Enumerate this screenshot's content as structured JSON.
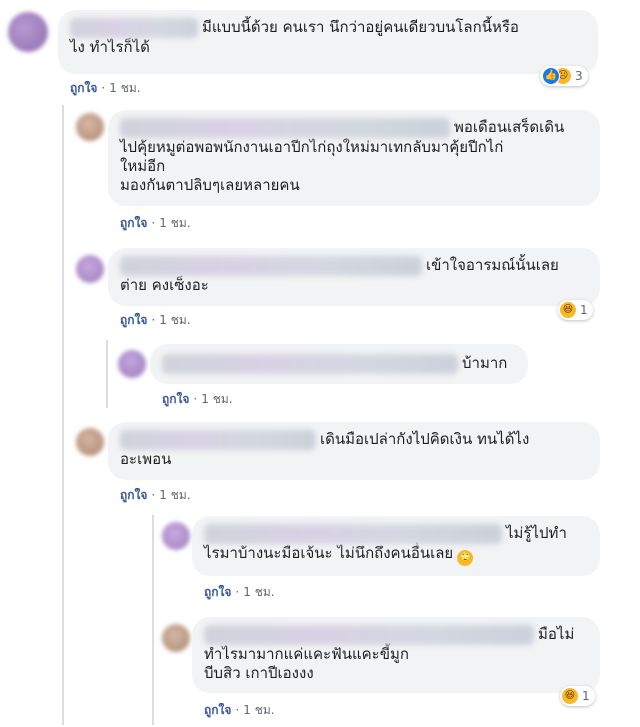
{
  "comments": [
    {
      "text": "มีแบบนี้ด้วย คนเรา นึกว่าอยู่คนเดียวบนโลกนี้หรือ\nไง ทำไรก็ได้",
      "like_label": "ถูกใจ",
      "time": "1 ชม.",
      "reaction_count": "3"
    },
    {
      "text_line1": "พอเดือนเสร็ดเดิน",
      "text_rest": "ไปคุ้ยหมูต่อพอพนักงานเอาปีกไก่ถุงใหม่มาเทกลับมาคุ้ยปีกไก่\nใหม่อีก\nมองกันตาปลิบๆเลยหลายคน",
      "like_label": "ถูกใจ",
      "time": "1 ชม."
    },
    {
      "text_line1": "เข้าใจอารมณ์นั้นเลย",
      "text_rest": "ต่าย คงเซ็งอะ",
      "like_label": "ถูกใจ",
      "time": "1 ชม.",
      "reaction_count": "1"
    },
    {
      "text_line1": "บ้ามาก",
      "like_label": "ถูกใจ",
      "time": "1 ชม."
    },
    {
      "text_line1": "เดินมือเปล่ากังไปคิดเงิน ทนได้ไง",
      "text_rest": "อะเพอน",
      "like_label": "ถูกใจ",
      "time": "1 ชม."
    },
    {
      "text_line1": "ไม่รู้ไปทำ",
      "text_rest": "ไรมาบ้างนะมือเจ้นะ ไม่นึกถึงคนอื่นเลย",
      "like_label": "ถูกใจ",
      "time": "1 ชม."
    },
    {
      "text_line1": "มือไม่",
      "text_rest": "ทำไรมามากแค่แคะฟันแคะขี้มูก\nบีบสิว เกาปีเองงง",
      "like_label": "ถูกใจ",
      "time": "1 ชม.",
      "reaction_count": "1"
    }
  ],
  "separator": "·",
  "icons": {
    "reaction_like": "thumbs-up-icon",
    "reaction_sad": "sad-face-icon",
    "reaction_haha": "laughing-face-icon",
    "inline_emoji": "rolling-eyes-emoji-icon"
  },
  "colors": {
    "bubble_bg": "#f2f3f5",
    "like_link": "#385898",
    "meta_text": "#606770",
    "thread_line": "#dadde1"
  }
}
